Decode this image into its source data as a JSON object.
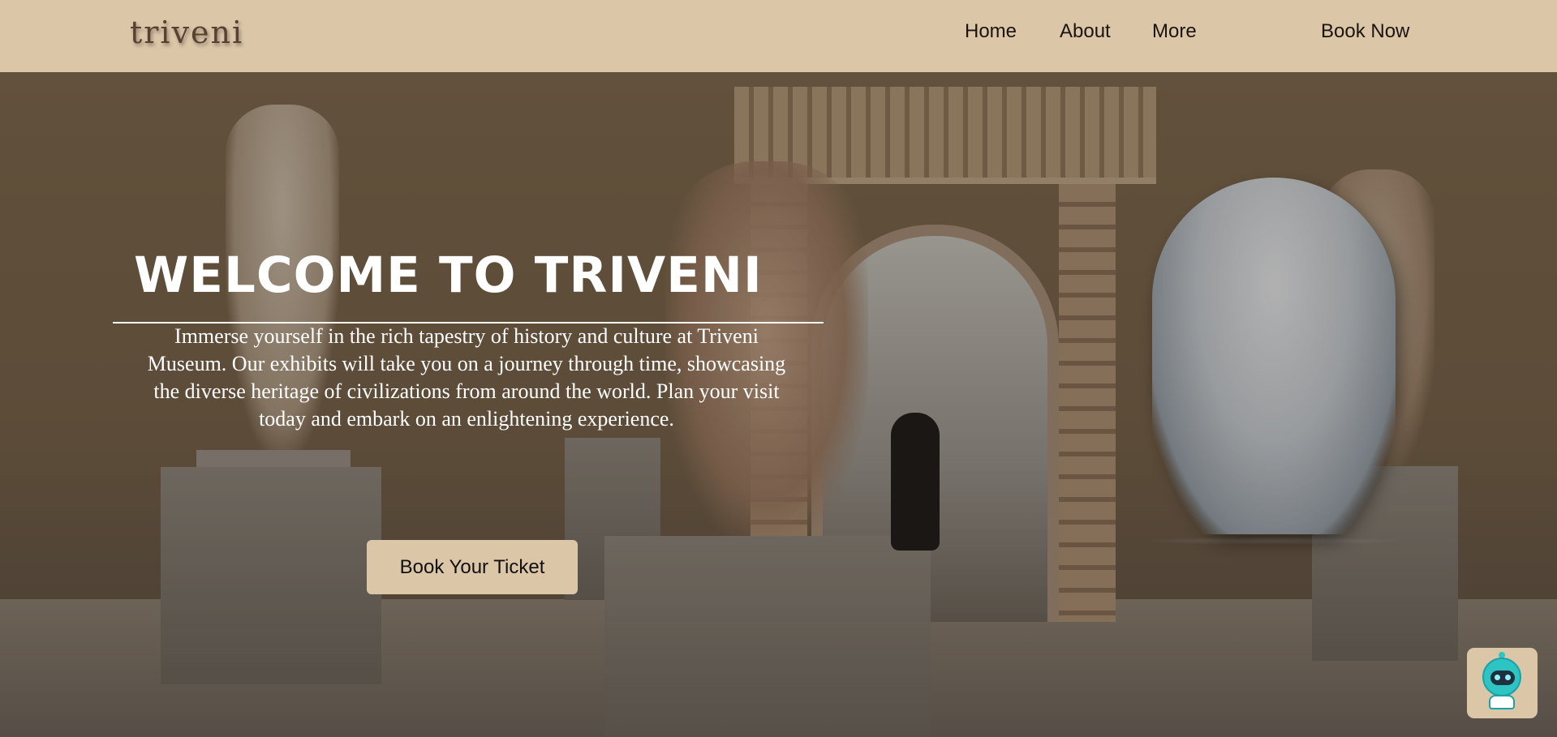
{
  "navbar": {
    "logo": "triveni",
    "links": [
      "Home",
      "About",
      "More"
    ],
    "cta": "Book Now",
    "background": "#dbc6a8"
  },
  "hero": {
    "title": "WELCOME TO TRIVENI",
    "description": "Immerse yourself in the rich tapestry of history and culture at Triveni Museum. Our exhibits will take you on a journey through time, showcasing the diverse heritage of civilizations from around the world. Plan your visit today and embark on an enlightening experience.",
    "button": "Book Your Ticket",
    "background_image": "museum gallery with marble statues, ornate archway and a bust of David"
  },
  "chatbot": {
    "icon": "robot-icon",
    "accent": "#2ec4c4"
  }
}
